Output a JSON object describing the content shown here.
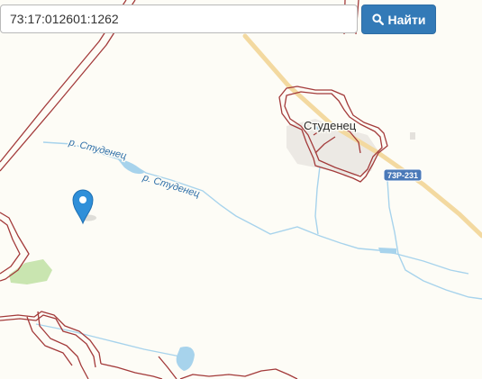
{
  "search": {
    "value": "73:17:012601:1262",
    "button_label": "Найти",
    "button_icon": "search-icon"
  },
  "map": {
    "labels": {
      "settlement": "Студенец",
      "river_1": "р. Студенец",
      "river_2": "р. Студенец",
      "road_shield": "73Р-231"
    },
    "marker_icon": "map-pin-icon",
    "colors": {
      "background": "#fdfcf6",
      "parcel_boundary": "#a33a3a",
      "road": "#f3d9a0",
      "water": "#a7d3ec",
      "river_label": "#2e6fa8",
      "road_shield": "#4a79b8",
      "marker": "#2f8fd9",
      "forest": "#c9e5b0"
    }
  }
}
